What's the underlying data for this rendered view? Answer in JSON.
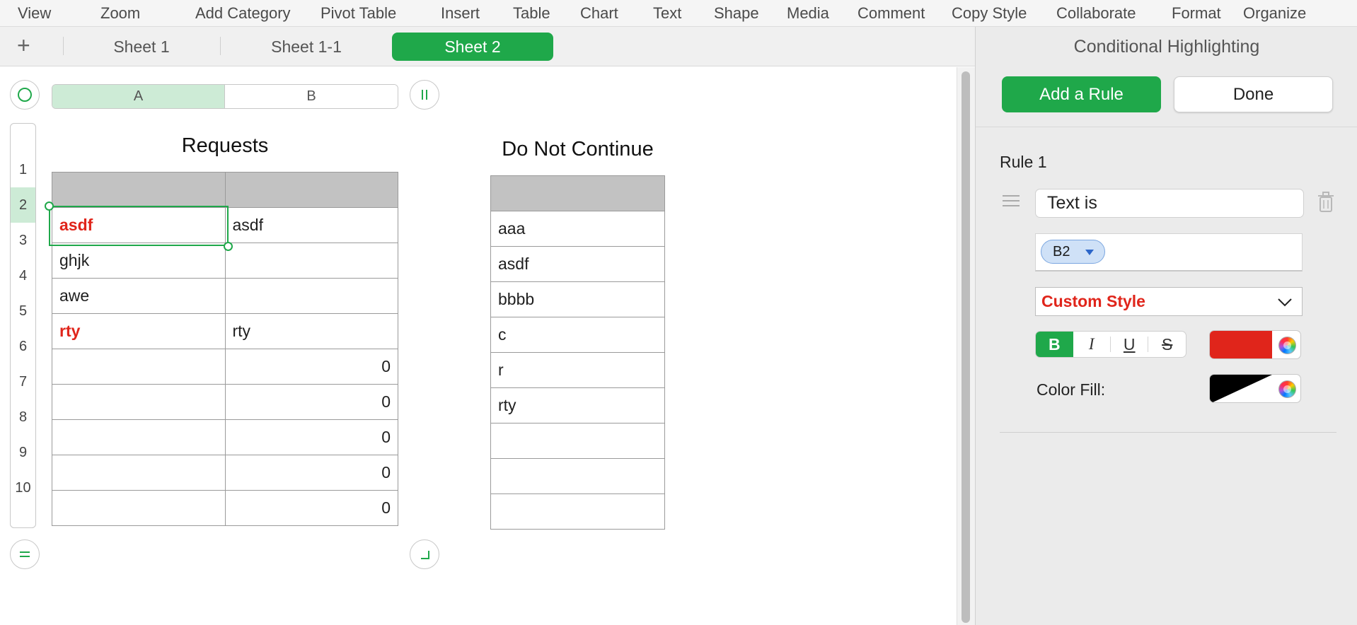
{
  "menubar": {
    "items": [
      "View",
      "Zoom",
      "Add Category",
      "Pivot Table",
      "Insert",
      "Table",
      "Chart",
      "Text",
      "Shape",
      "Media",
      "Comment",
      "Copy Style",
      "Collaborate",
      "Format",
      "Organize"
    ]
  },
  "tabs": {
    "add_label": "+",
    "items": [
      "Sheet 1",
      "Sheet 1-1",
      "Sheet 2"
    ],
    "active": "Sheet 2"
  },
  "column_headers": [
    "A",
    "B"
  ],
  "row_headers": [
    "1",
    "2",
    "3",
    "4",
    "5",
    "6",
    "7",
    "8",
    "9",
    "10"
  ],
  "table_requests": {
    "title": "Requests",
    "rows": [
      [
        "",
        ""
      ],
      [
        "asdf",
        "asdf"
      ],
      [
        "ghjk",
        ""
      ],
      [
        "awe",
        ""
      ],
      [
        "rty",
        "rty"
      ],
      [
        "",
        "0"
      ],
      [
        "",
        "0"
      ],
      [
        "",
        "0"
      ],
      [
        "",
        "0"
      ],
      [
        "",
        "0"
      ]
    ],
    "highlighted_cells": [
      "A2",
      "A5"
    ],
    "selected_cell": "A2"
  },
  "table_do_not_continue": {
    "title": "Do Not Continue",
    "rows": [
      "",
      "aaa",
      "asdf",
      "bbbb",
      "c",
      "r",
      "rty",
      "",
      "",
      ""
    ]
  },
  "sidebar": {
    "title": "Conditional Highlighting",
    "add_rule_label": "Add a Rule",
    "done_label": "Done",
    "rule_label": "Rule 1",
    "rule_type": "Text is",
    "reference_token": "B2",
    "style_select": "Custom Style",
    "format_buttons": [
      "B",
      "I",
      "U",
      "S"
    ],
    "text_color": "#e0251b",
    "color_fill_label": "Color Fill:"
  },
  "colors": {
    "accent": "#1fa84a",
    "highlight_text": "#e0251b",
    "header_fill": "#c2c2c2"
  }
}
